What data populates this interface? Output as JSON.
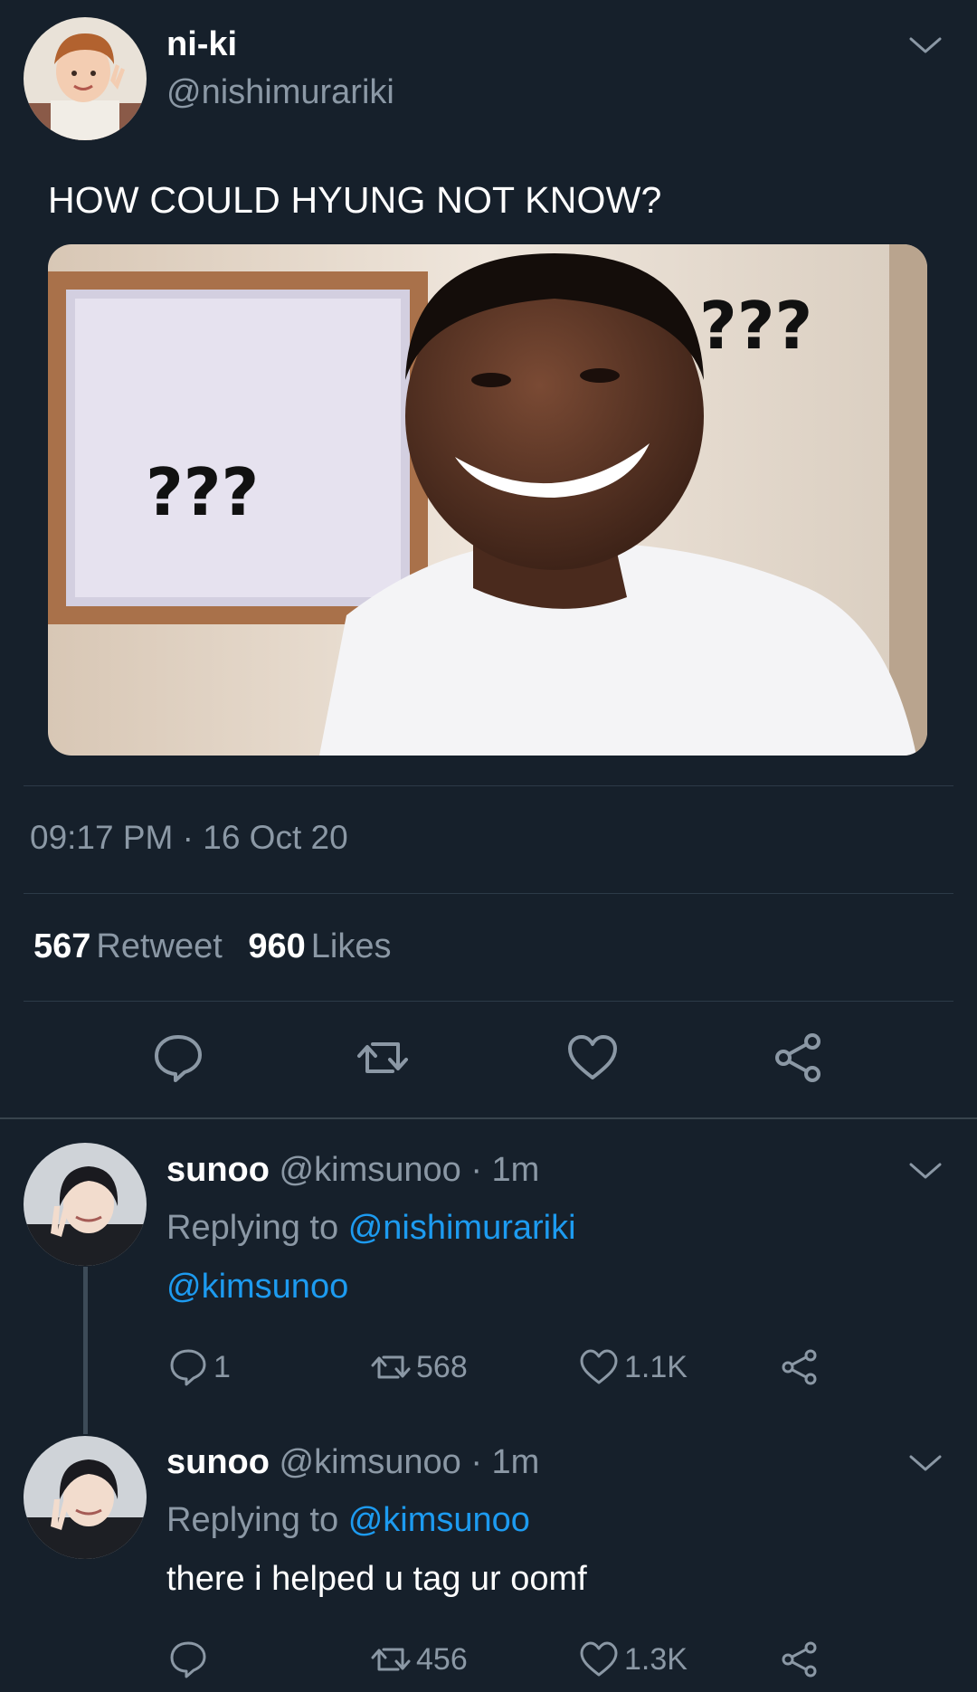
{
  "colors": {
    "background": "#16202b",
    "secondary_text": "#8b98a5",
    "link": "#1d9bf0",
    "divider": "#2c3a48"
  },
  "main_tweet": {
    "display_name": "ni-ki",
    "handle": "@nishimurariki",
    "text": "HOW COULD HYUNG NOT KNOW?",
    "media_text_left": "???",
    "media_text_right": "???",
    "timestamp": "09:17 PM · 16 Oct 20",
    "retweet_count": "567",
    "retweet_label": "Retweet",
    "like_count": "960",
    "like_label": "Likes",
    "actions": [
      "reply-icon",
      "retweet-icon",
      "heart-icon",
      "share-icon"
    ]
  },
  "replies": [
    {
      "display_name": "sunoo",
      "handle": "@kimsunoo",
      "time": "· 1m",
      "replying_label": "Replying to",
      "replying_to": "@nishimurariki",
      "body_mention": "@kimsunoo",
      "body_text": "",
      "reply_count": "1",
      "retweet_count": "568",
      "like_count": "1.1K"
    },
    {
      "display_name": "sunoo",
      "handle": "@kimsunoo",
      "time": "· 1m",
      "replying_label": "Replying to",
      "replying_to": "@kimsunoo",
      "body_mention": "",
      "body_text": "there i helped u tag ur oomf",
      "reply_count": "",
      "retweet_count": "456",
      "like_count": "1.3K"
    }
  ]
}
